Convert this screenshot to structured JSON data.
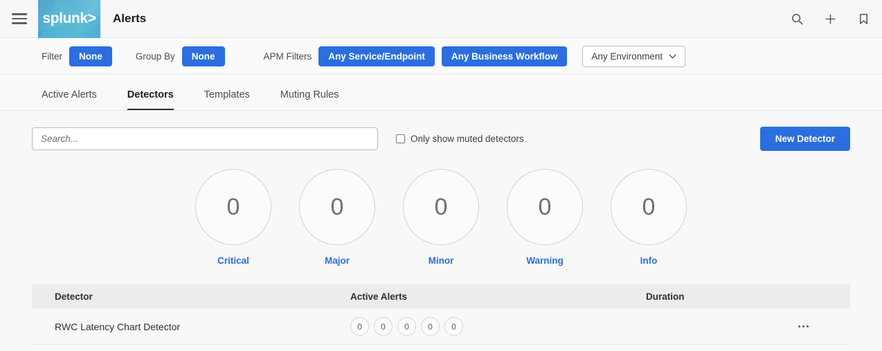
{
  "header": {
    "menu_icon": "hamburger-menu-icon",
    "logo_text": "splunk>",
    "title": "Alerts",
    "actions": [
      {
        "icon": "search-icon",
        "name": "search"
      },
      {
        "icon": "plus-icon",
        "name": "add"
      },
      {
        "icon": "bookmark-icon",
        "name": "bookmark"
      }
    ]
  },
  "filterbar": {
    "filter_label": "Filter",
    "filter_value": "None",
    "groupby_label": "Group By",
    "groupby_value": "None",
    "apm_label": "APM Filters",
    "apm_service": "Any Service/Endpoint",
    "apm_workflow": "Any Business Workflow",
    "environment": "Any Environment"
  },
  "tabs": [
    {
      "label": "Active Alerts",
      "active": false
    },
    {
      "label": "Detectors",
      "active": true
    },
    {
      "label": "Templates",
      "active": false
    },
    {
      "label": "Muting Rules",
      "active": false
    }
  ],
  "toolbar": {
    "search_placeholder": "Search...",
    "search_value": "",
    "muted_checkbox_label": "Only show muted detectors",
    "muted_checked": false,
    "new_detector_label": "New Detector"
  },
  "severity_summary": [
    {
      "label": "Critical",
      "count": "0"
    },
    {
      "label": "Major",
      "count": "0"
    },
    {
      "label": "Minor",
      "count": "0"
    },
    {
      "label": "Warning",
      "count": "0"
    },
    {
      "label": "Info",
      "count": "0"
    }
  ],
  "table": {
    "columns": [
      "Detector",
      "Active Alerts",
      "Duration"
    ],
    "rows": [
      {
        "detector": "RWC Latency Chart Detector",
        "active_alerts": [
          "0",
          "0",
          "0",
          "0",
          "0"
        ],
        "duration": "",
        "menu": "row-options"
      }
    ]
  },
  "colors": {
    "accent_blue": "#2a6ee0",
    "logo_blue": "#4ba9d0",
    "text_dark": "#2b2e2f",
    "text_muted": "#6d7071",
    "page_bg": "#f8f8f8",
    "table_header_bg": "#ececec"
  }
}
